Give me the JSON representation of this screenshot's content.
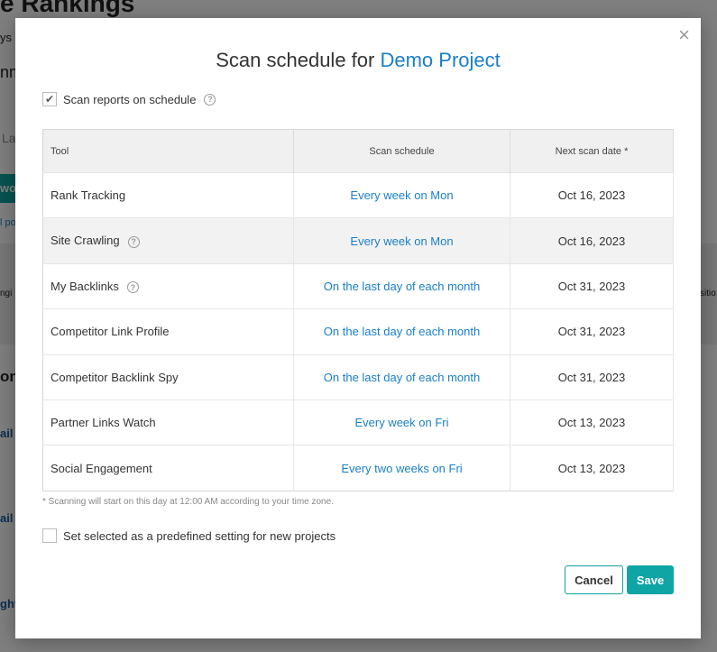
{
  "background": {
    "title": "e Rankings",
    "fragments": [
      "ys a",
      "nm",
      "La",
      "wor",
      "l po",
      "ngi",
      "sitio",
      "on",
      "ail",
      "ail",
      "ghtv"
    ]
  },
  "modal": {
    "title_prefix": "Scan schedule for",
    "project": "Demo Project",
    "scan_on_schedule": {
      "label": "Scan reports on schedule",
      "checked": true
    },
    "columns": [
      "Tool",
      "Scan schedule",
      "Next scan date *"
    ],
    "rows": [
      {
        "tool": "Rank Tracking",
        "help": false,
        "schedule": "Every week on Mon",
        "next": "Oct 16, 2023"
      },
      {
        "tool": "Site Crawling",
        "help": true,
        "schedule": "Every week on Mon",
        "next": "Oct 16, 2023"
      },
      {
        "tool": "My Backlinks",
        "help": true,
        "schedule": "On the last day of each month",
        "next": "Oct 31, 2023"
      },
      {
        "tool": "Competitor Link Profile",
        "help": false,
        "schedule": "On the last day of each month",
        "next": "Oct 31, 2023"
      },
      {
        "tool": "Competitor Backlink Spy",
        "help": false,
        "schedule": "On the last day of each month",
        "next": "Oct 31, 2023"
      },
      {
        "tool": "Partner Links Watch",
        "help": false,
        "schedule": "Every week on Fri",
        "next": "Oct 13, 2023"
      },
      {
        "tool": "Social Engagement",
        "help": false,
        "schedule": "Every two weeks on Fri",
        "next": "Oct 13, 2023"
      }
    ],
    "note": "* Scanning will start on this day at 12:00 AM according to your time zone.",
    "predefined": {
      "label": "Set selected as a predefined setting for new projects",
      "checked": false
    },
    "cancel": "Cancel",
    "save": "Save",
    "close": "×",
    "help_glyph": "?"
  },
  "colors": {
    "accent": "#10a5a5",
    "link": "#1a7fc7"
  }
}
